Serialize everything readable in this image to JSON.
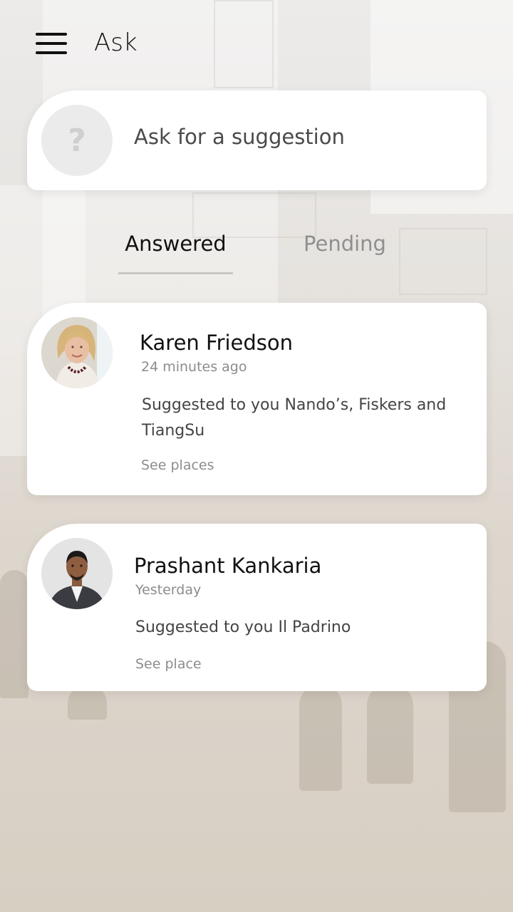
{
  "header": {
    "title": "Ask",
    "menu_icon": "hamburger-menu-icon"
  },
  "ask_card": {
    "avatar_glyph": "?",
    "prompt": "Ask for a suggestion"
  },
  "tabs": [
    {
      "label": "Answered",
      "active": true
    },
    {
      "label": "Pending",
      "active": false
    }
  ],
  "suggestions": [
    {
      "name": "Karen Friedson",
      "time": "24 minutes ago",
      "message": "Suggested to you Nando’s, Fiskers and TiangSu",
      "link": "See places"
    },
    {
      "name": "Prashant Kankaria",
      "time": "Yesterday",
      "message": "Suggested to you Il Padrino",
      "link": "See place"
    }
  ],
  "colors": {
    "text_primary": "#111111",
    "text_secondary": "#8c8c8c",
    "card_background": "#ffffff"
  }
}
